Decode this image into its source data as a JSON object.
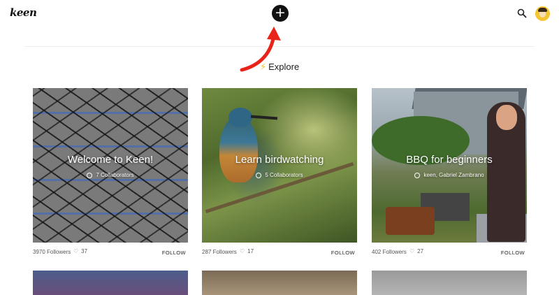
{
  "header": {
    "logo_text": "keen",
    "add_button_symbol": "+",
    "search_icon": "search-icon",
    "avatar": "user-avatar"
  },
  "explore": {
    "icon": "lightning-bolt-icon",
    "label": "Explore"
  },
  "annotation": {
    "arrow_color": "#e8241a"
  },
  "cards": [
    {
      "title": "Welcome to Keen!",
      "subtitle": "7 Collaborators",
      "followers": "3970 Followers",
      "likes": "37",
      "follow_label": "FOLLOW"
    },
    {
      "title": "Learn birdwatching",
      "subtitle": "5 Collaborators",
      "followers": "287 Followers",
      "likes": "17",
      "follow_label": "FOLLOW"
    },
    {
      "title": "BBQ for beginners",
      "subtitle": "keen, Gabriel Zambrano",
      "followers": "402 Followers",
      "likes": "27",
      "follow_label": "FOLLOW"
    }
  ]
}
